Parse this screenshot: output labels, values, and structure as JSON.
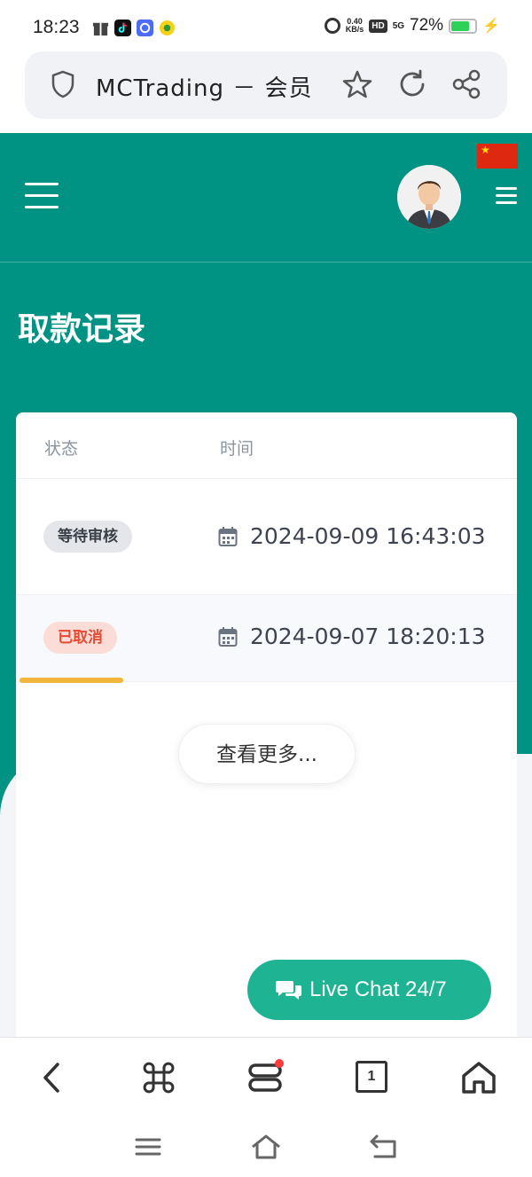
{
  "status_bar": {
    "time": "18:23",
    "speed_value": "0.40",
    "speed_unit": "KB/s",
    "hd": "HD",
    "network": "5G",
    "battery": "72%"
  },
  "browser": {
    "page_title": "MCTrading － 会员",
    "tab_count": "1"
  },
  "header": {
    "heading": "取款记录"
  },
  "table": {
    "columns": [
      "状态",
      "时间"
    ],
    "rows": [
      {
        "status": "等待审核",
        "status_type": "pending",
        "datetime": "2024-09-09 16:43:03"
      },
      {
        "status": "已取消",
        "status_type": "cancelled",
        "datetime": "2024-09-07 18:20:13"
      }
    ],
    "view_more": "查看更多..."
  },
  "live_chat": {
    "label": "Live Chat 24/7"
  },
  "colors": {
    "brand_green": "#009383",
    "chat_green": "#1db393",
    "cancel_red": "#e64a33",
    "scroll_indicator": "#f2b63c"
  }
}
